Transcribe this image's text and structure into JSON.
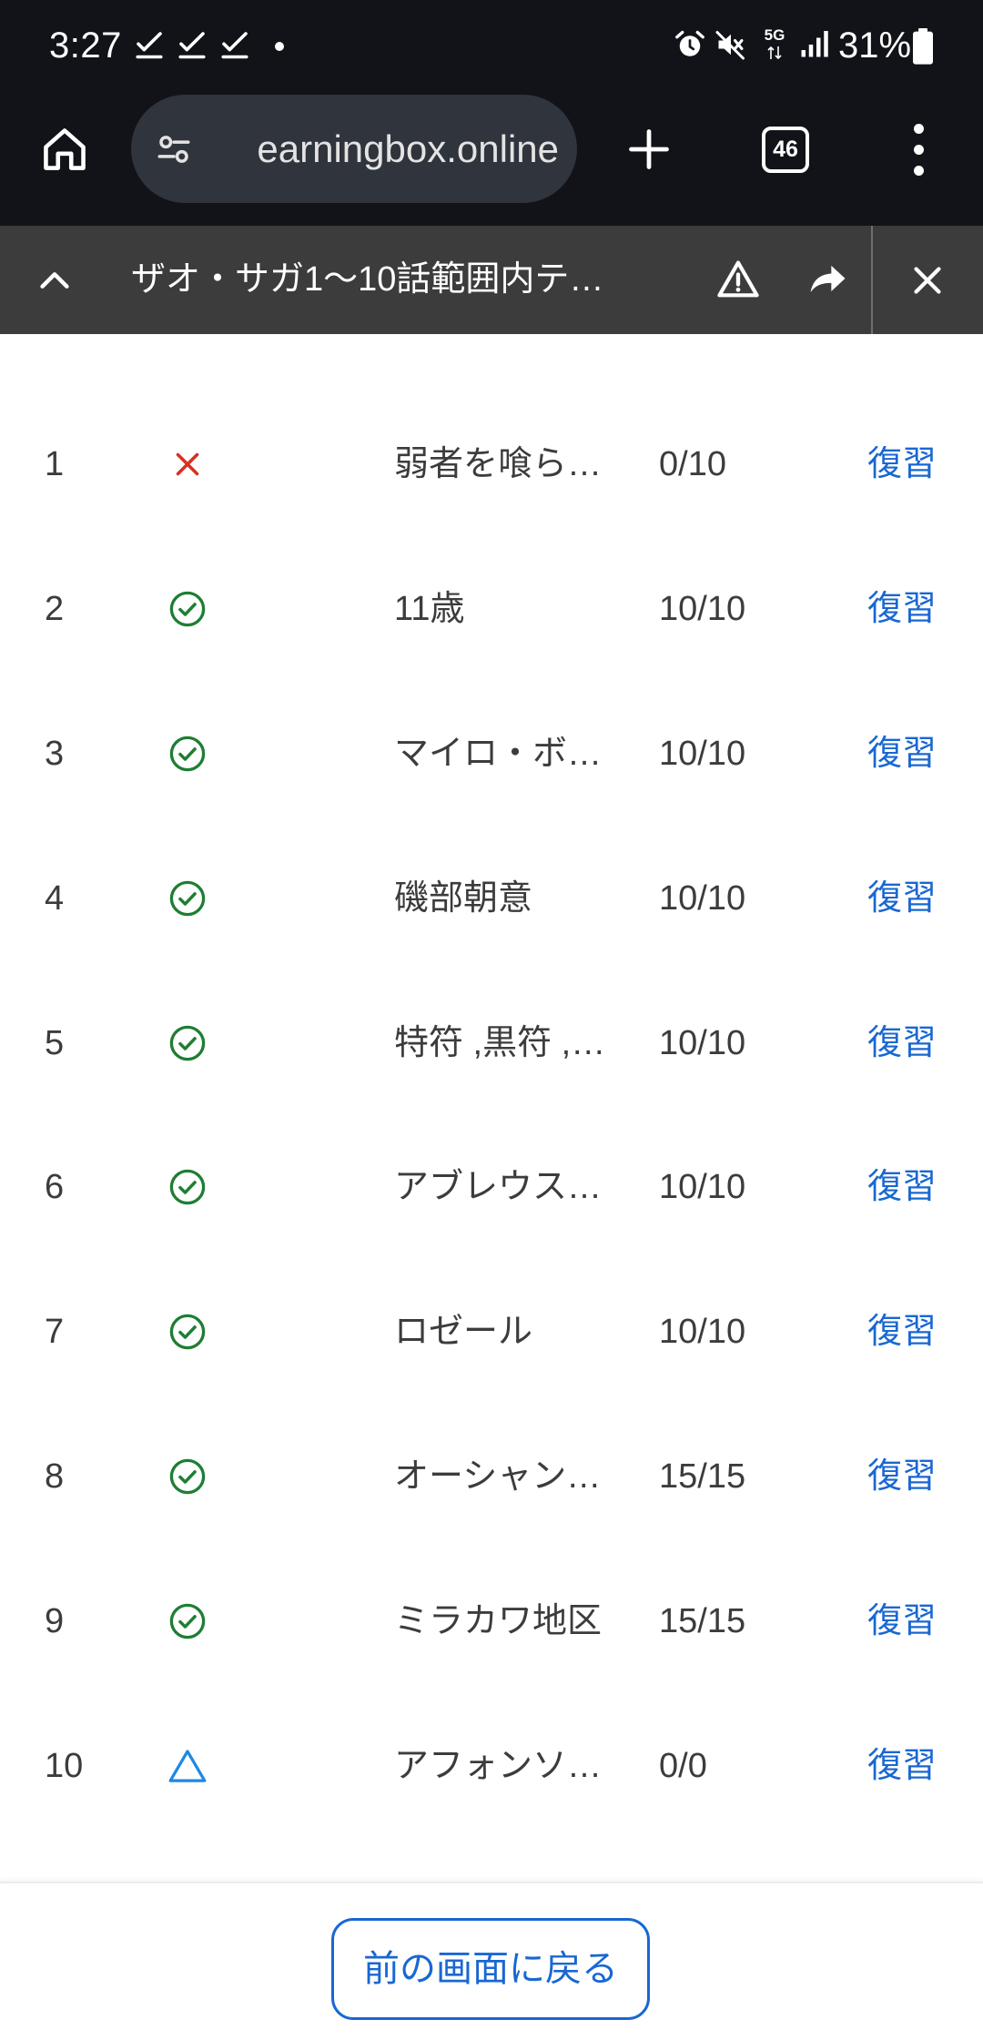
{
  "status_bar": {
    "time": "3:27",
    "left_icons": [
      "check-icon",
      "check-icon",
      "check-icon",
      "dot-icon"
    ],
    "right_icons": [
      "alarm-icon",
      "mute-icon",
      "network-type-icon",
      "signal-icon",
      "battery-icon"
    ],
    "network": "5G",
    "battery": "31%"
  },
  "browser": {
    "url": "earningbox.online",
    "tab_count": "46",
    "icons": [
      "home-icon",
      "tune-icon",
      "plus-icon",
      "tab-switcher-icon",
      "more-vert-icon"
    ]
  },
  "find_bar": {
    "title": "ザオ・サガ1〜10話範囲内テ…",
    "icons": [
      "chevron-up-icon",
      "warning-icon",
      "share-icon",
      "close-icon"
    ]
  },
  "colors": {
    "status_bar_bg": "#121318",
    "find_bar_bg": "#3c3c3c",
    "text": "#3c3c3c",
    "link": "#1967d2",
    "correct": "#1e7e34",
    "wrong": "#d93025",
    "pending": "#1e88e5"
  },
  "rows": [
    {
      "no": "1",
      "status_icon": "cross-icon",
      "title": "弱者を喰ら…",
      "score": "0/10",
      "action": "復習"
    },
    {
      "no": "2",
      "status_icon": "check-circle-icon",
      "title": "11歳",
      "score": "10/10",
      "action": "復習"
    },
    {
      "no": "3",
      "status_icon": "check-circle-icon",
      "title": "マイロ・ボ…",
      "score": "10/10",
      "action": "復習"
    },
    {
      "no": "4",
      "status_icon": "check-circle-icon",
      "title": "磯部朝意",
      "score": "10/10",
      "action": "復習"
    },
    {
      "no": "5",
      "status_icon": "check-circle-icon",
      "title": "特符 ,黒符 ,…",
      "score": "10/10",
      "action": "復習"
    },
    {
      "no": "6",
      "status_icon": "check-circle-icon",
      "title": "アブレウス…",
      "score": "10/10",
      "action": "復習"
    },
    {
      "no": "7",
      "status_icon": "check-circle-icon",
      "title": "ロゼール",
      "score": "10/10",
      "action": "復習"
    },
    {
      "no": "8",
      "status_icon": "check-circle-icon",
      "title": "オーシャン…",
      "score": "15/15",
      "action": "復習"
    },
    {
      "no": "9",
      "status_icon": "check-circle-icon",
      "title": "ミラカワ地区",
      "score": "15/15",
      "action": "復習"
    },
    {
      "no": "10",
      "status_icon": "triangle-icon",
      "title": "アフォンソ…",
      "score": "0/0",
      "action": "復習"
    }
  ],
  "footer": {
    "back_label": "前の画面に戻る"
  }
}
